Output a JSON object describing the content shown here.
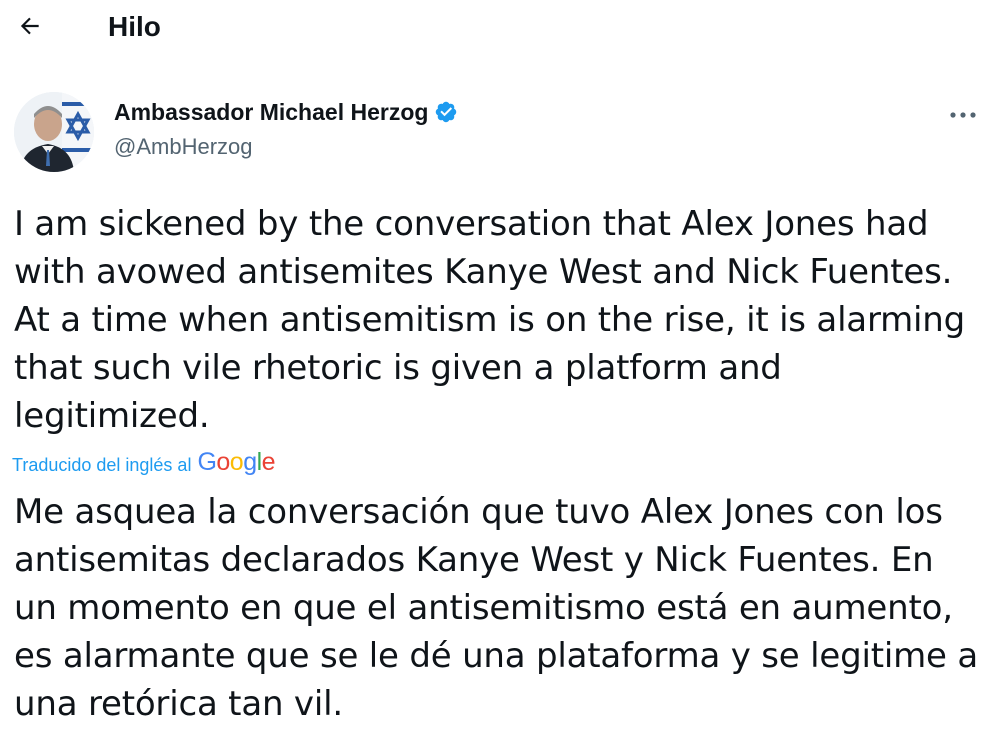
{
  "header": {
    "back_icon": "arrow-left-icon",
    "title": "Hilo"
  },
  "tweet": {
    "author_name": "Ambassador Michael Herzog",
    "handle": "@AmbHerzog",
    "verified_icon": "verified-badge-icon",
    "more_icon": "more-horizontal-icon",
    "text": "I am sickened by the conversation that Alex Jones had with avowed antisemites Kanye West and Nick Fuentes. At a time when antisemitism is on the rise, it is alarming that such vile rhetoric is given a platform and legitimized.",
    "translation_label": "Traducido del inglés al",
    "translation_provider": "Google",
    "translated_text": "Me asquea la conversación que tuvo Alex Jones con los antisemitas declarados Kanye West y Nick Fuentes. En un momento en que el antisemitismo está en aumento, es alarmante que se le dé una plataforma y se legitime a una retórica tan vil."
  },
  "colors": {
    "accent": "#1d9bf0",
    "text": "#0f1419",
    "secondary_text": "#536471"
  }
}
